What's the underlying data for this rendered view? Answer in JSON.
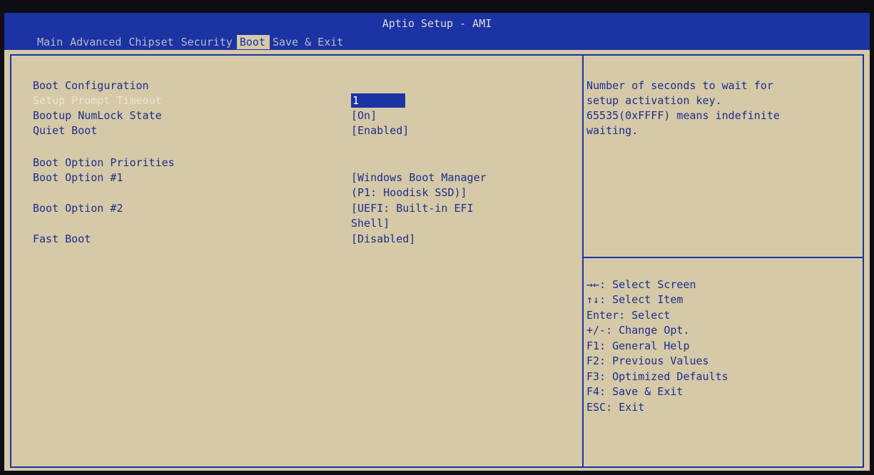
{
  "title": "Aptio Setup - AMI",
  "tabs": [
    "Main",
    "Advanced",
    "Chipset",
    "Security",
    "Boot",
    "Save & Exit"
  ],
  "active_tab": "Boot",
  "settings": {
    "section_config": "Boot Configuration",
    "setup_prompt_timeout": {
      "label": "Setup Prompt Timeout",
      "value": "1"
    },
    "bootup_numlock": {
      "label": "Bootup NumLock State",
      "value": "[On]"
    },
    "quiet_boot": {
      "label": "Quiet Boot",
      "value": "[Enabled]"
    },
    "section_priorities": "Boot Option Priorities",
    "boot_option_1": {
      "label": "Boot Option #1",
      "value_line1": "[Windows Boot Manager",
      "value_line2": "(P1: Hoodisk SSD)]"
    },
    "boot_option_2": {
      "label": "Boot Option #2",
      "value_line1": "[UEFI: Built-in EFI",
      "value_line2": "Shell]"
    },
    "fast_boot": {
      "label": "Fast Boot",
      "value": "[Disabled]"
    }
  },
  "help": {
    "lines": [
      "Number of seconds to wait for",
      "setup activation key.",
      "65535(0xFFFF) means indefinite",
      "waiting."
    ]
  },
  "keys": [
    "→←: Select Screen",
    "↑↓: Select Item",
    "Enter: Select",
    "+/-: Change Opt.",
    "F1: General Help",
    "F2: Previous Values",
    "F3: Optimized Defaults",
    "F4: Save & Exit",
    "ESC: Exit"
  ],
  "colors": {
    "bar_blue": "#1b33a3",
    "panel_beige": "#d5c9a8",
    "text_blue": "#1c2f8a",
    "highlight_text": "#ece4cf"
  }
}
